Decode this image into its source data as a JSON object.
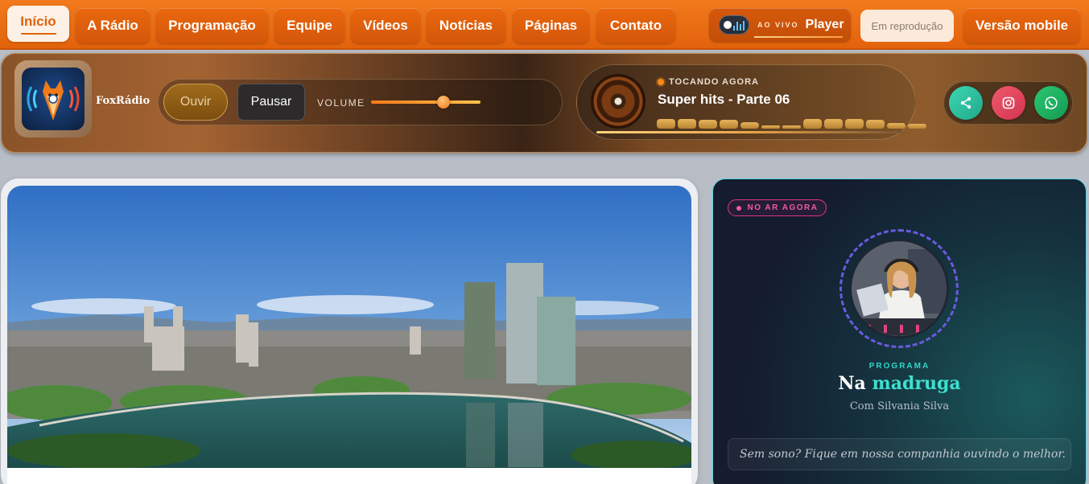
{
  "nav": {
    "items": [
      {
        "label": "Início",
        "active": true
      },
      {
        "label": "A Rádio"
      },
      {
        "label": "Programação"
      },
      {
        "label": "Equipe"
      },
      {
        "label": "Vídeos"
      },
      {
        "label": "Notícias"
      },
      {
        "label": "Páginas"
      },
      {
        "label": "Contato"
      }
    ],
    "player": {
      "live_label": "AO VIVO",
      "label": "Player"
    },
    "now_playing_tab": "Em reprodução",
    "mobile": "Versão mobile"
  },
  "header": {
    "brand": "FoxRádio",
    "listen_label": "Ouvir",
    "pause_label": "Pausar",
    "volume_label": "VOLUME",
    "volume_level": 0.66,
    "now_playing_label": "TOCANDO AGORA",
    "track": "Super hits - Parte 06",
    "eq_levels": [
      0.85,
      0.85,
      0.8,
      0.8,
      0.55,
      0.3,
      0.3,
      0.85,
      0.85,
      0.85,
      0.8,
      0.5,
      0.4
    ],
    "social": [
      {
        "name": "share-icon",
        "color": "#2bc4a3"
      },
      {
        "name": "instagram-icon",
        "color": "#e2455f"
      },
      {
        "name": "whatsapp-icon",
        "color": "#1fae63"
      }
    ]
  },
  "live": {
    "badge": "NO AR AGORA",
    "program_label": "PROGRAMA",
    "title_a": "Na",
    "title_b": "madruga",
    "host": "Com Silvania Silva",
    "quote": "Sem sono? Fique em nossa companhia ouvindo o melhor."
  },
  "colors": {
    "accent": "#e8680e",
    "teal": "#3ee0cf",
    "pink": "#e0358a"
  }
}
